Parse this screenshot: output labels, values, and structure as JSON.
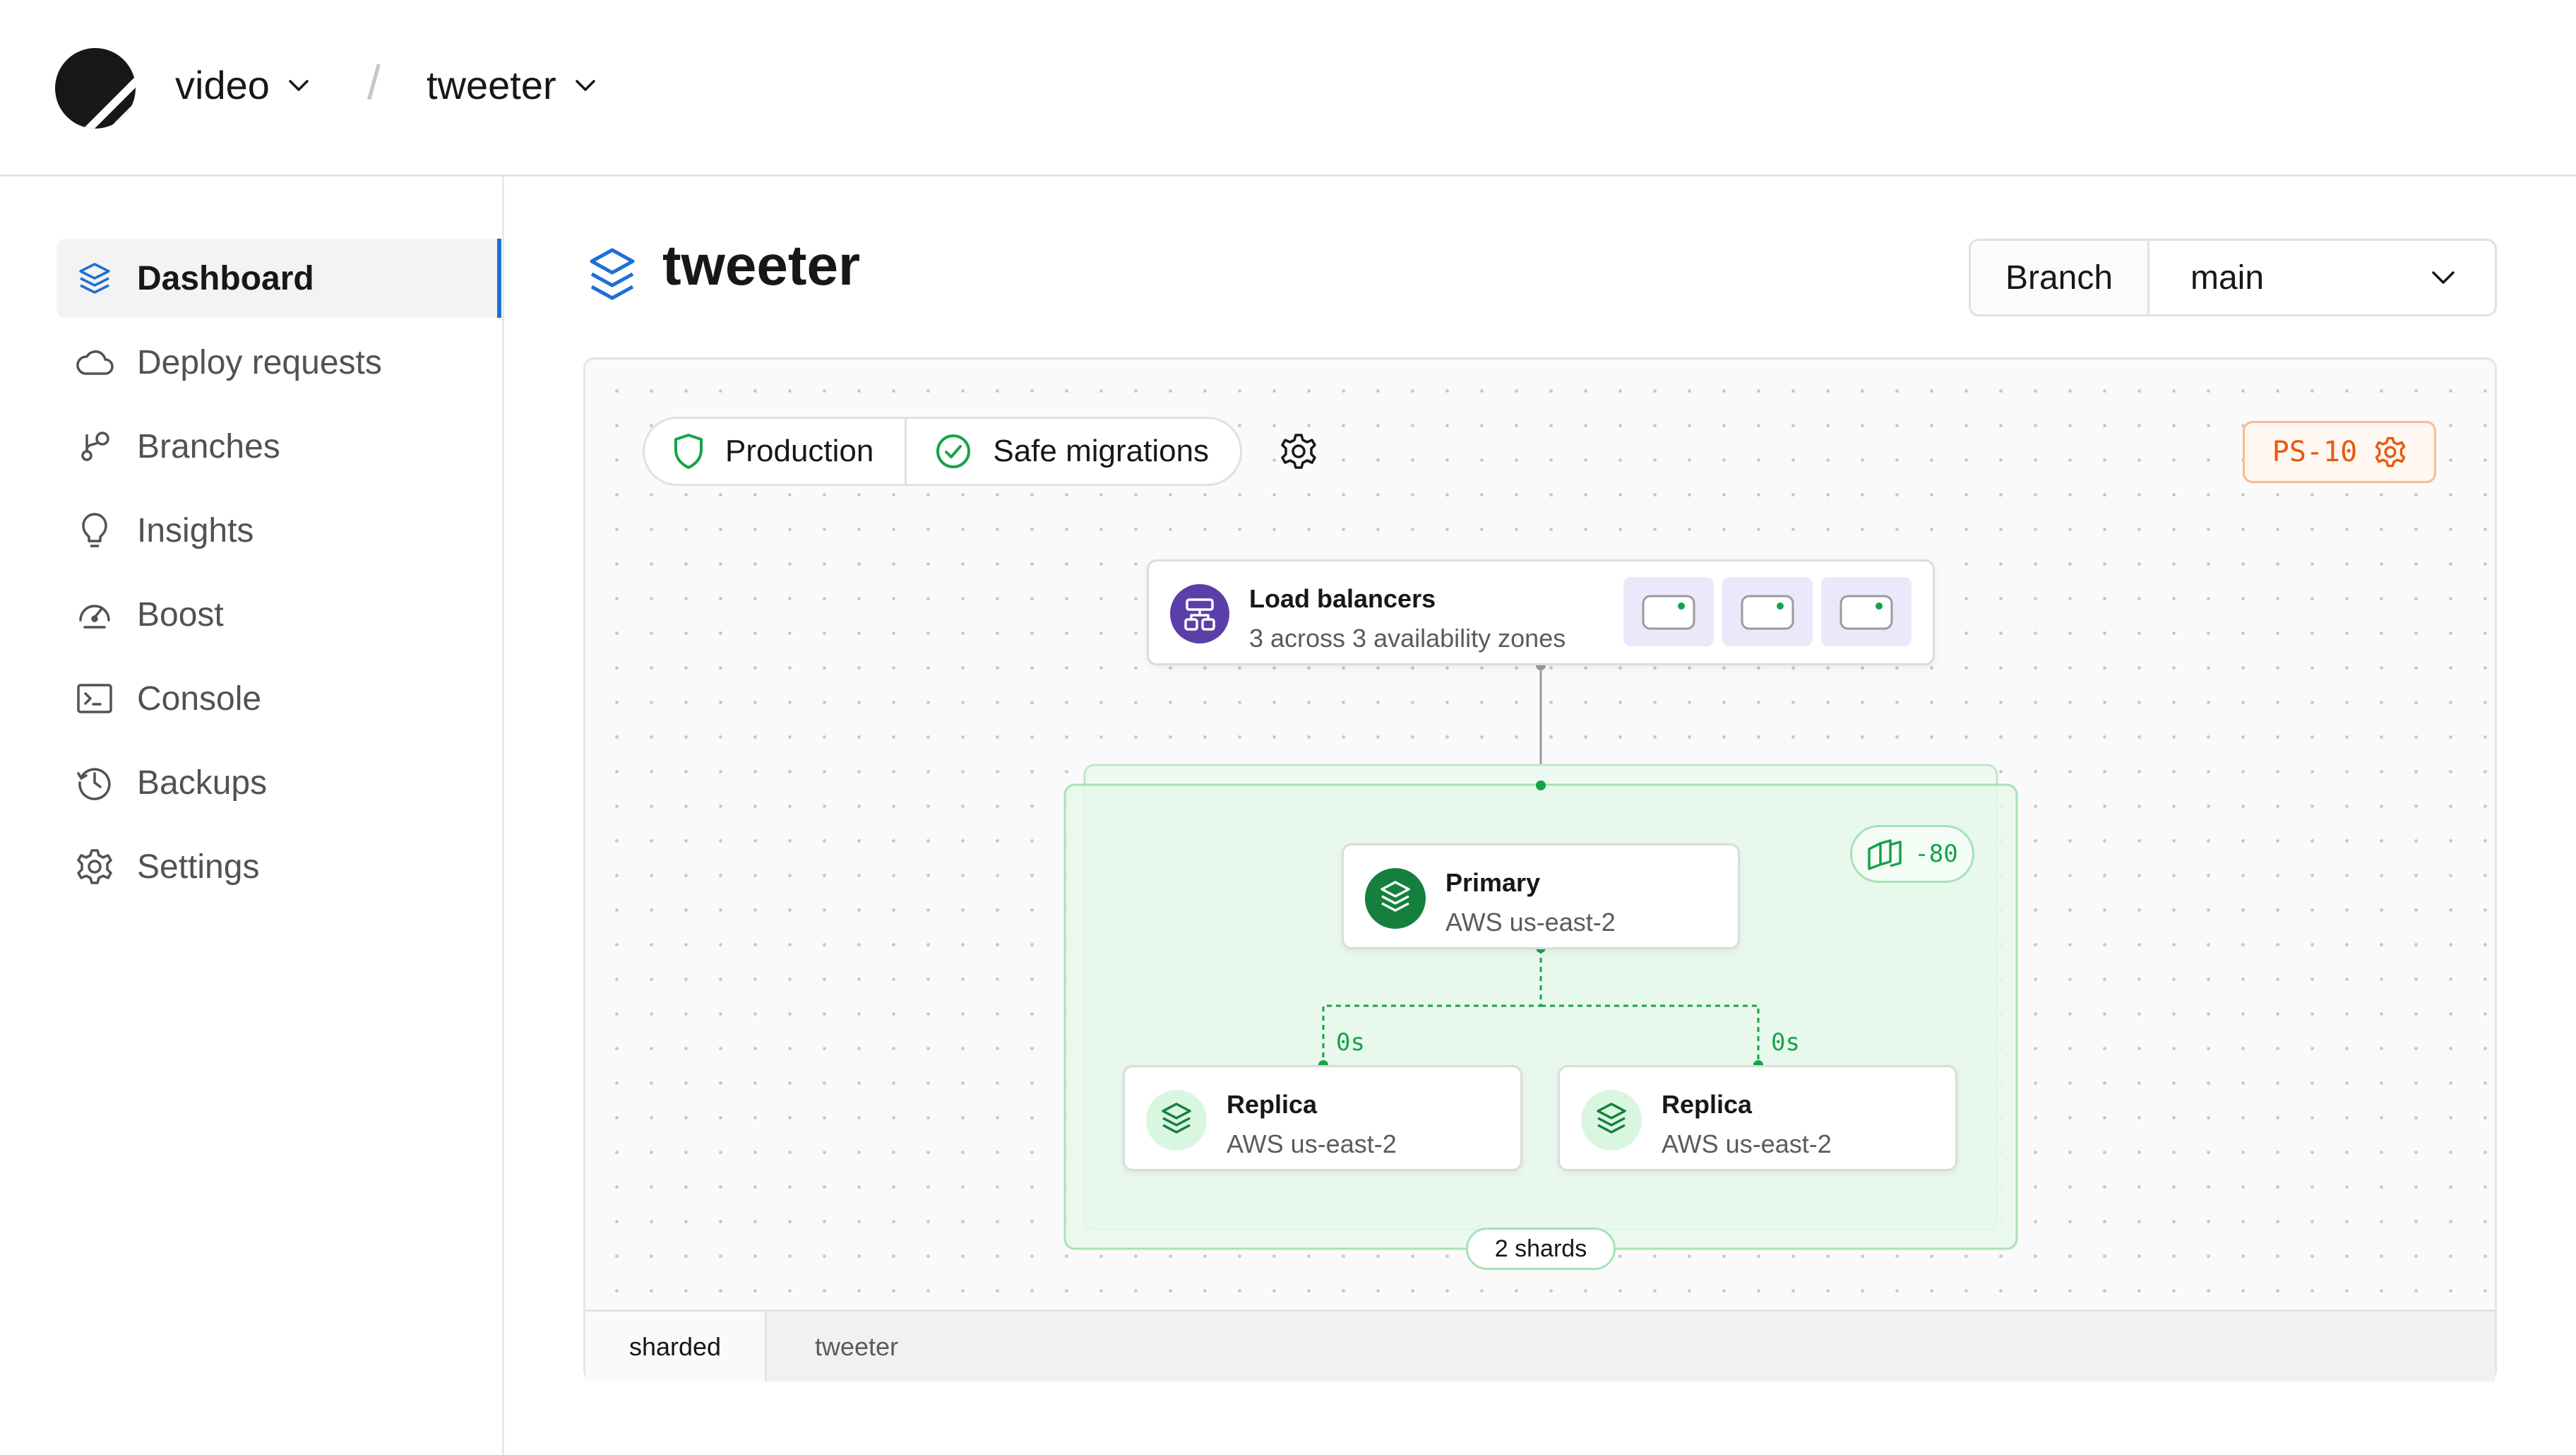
{
  "header": {
    "org": "video",
    "database": "tweeter",
    "separator": "/"
  },
  "sidebar": {
    "items": [
      {
        "label": "Dashboard",
        "icon": "stack-icon",
        "active": true
      },
      {
        "label": "Deploy requests",
        "icon": "cloud-icon"
      },
      {
        "label": "Branches",
        "icon": "branch-icon"
      },
      {
        "label": "Insights",
        "icon": "lightbulb-icon"
      },
      {
        "label": "Boost",
        "icon": "gauge-icon"
      },
      {
        "label": "Console",
        "icon": "terminal-icon"
      },
      {
        "label": "Backups",
        "icon": "clock-icon"
      },
      {
        "label": "Settings",
        "icon": "gear-icon"
      }
    ]
  },
  "main": {
    "title": "tweeter",
    "branch_label": "Branch",
    "branch_value": "main",
    "badges": {
      "production": "Production",
      "safe_migrations": "Safe migrations"
    },
    "cluster_size": "PS-10",
    "load_balancers": {
      "title": "Load balancers",
      "subtitle": "3 across 3 availability zones",
      "count": 3
    },
    "shard_range": "-80",
    "primary": {
      "title": "Primary",
      "region": "AWS us-east-2"
    },
    "replicas": [
      {
        "title": "Replica",
        "region": "AWS us-east-2",
        "lag": "0s"
      },
      {
        "title": "Replica",
        "region": "AWS us-east-2",
        "lag": "0s"
      }
    ],
    "shards_label": "2 shards",
    "tabs": [
      "sharded",
      "tweeter"
    ],
    "active_tab": "sharded"
  },
  "colors": {
    "accent_blue": "#1d6fd6",
    "green": "#16a34a",
    "shard_fill": "#e9f9ee",
    "orange": "#ea580c",
    "purple": "#5b3fa8"
  }
}
